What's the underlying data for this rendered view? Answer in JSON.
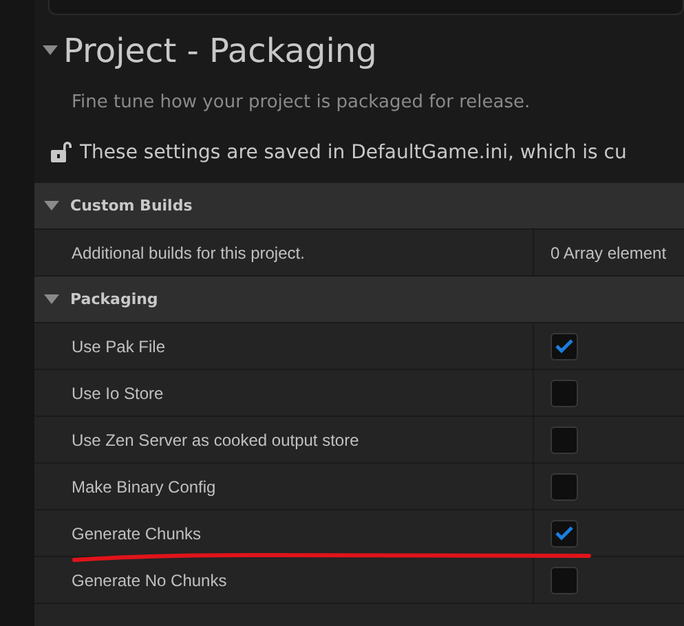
{
  "header": {
    "title": "Project - Packaging",
    "expanded": true,
    "description": "Fine tune how your project is packaged for release.",
    "notice": "These settings are saved in DefaultGame.ini, which is cu"
  },
  "sections": [
    {
      "title": "Custom Builds",
      "expanded": true,
      "rows": [
        {
          "label": "Additional builds for this project.",
          "kind": "text",
          "value": "0 Array element"
        }
      ]
    },
    {
      "title": "Packaging",
      "expanded": true,
      "rows": [
        {
          "label": "Use Pak File",
          "kind": "checkbox",
          "checked": true
        },
        {
          "label": "Use Io Store",
          "kind": "checkbox",
          "checked": false
        },
        {
          "label": "Use Zen Server as cooked output store",
          "kind": "checkbox",
          "checked": false
        },
        {
          "label": "Make Binary Config",
          "kind": "checkbox",
          "checked": false
        },
        {
          "label": "Generate Chunks",
          "kind": "checkbox",
          "checked": true,
          "underlined": true
        },
        {
          "label": "Generate No Chunks",
          "kind": "checkbox",
          "checked": false
        }
      ]
    }
  ]
}
